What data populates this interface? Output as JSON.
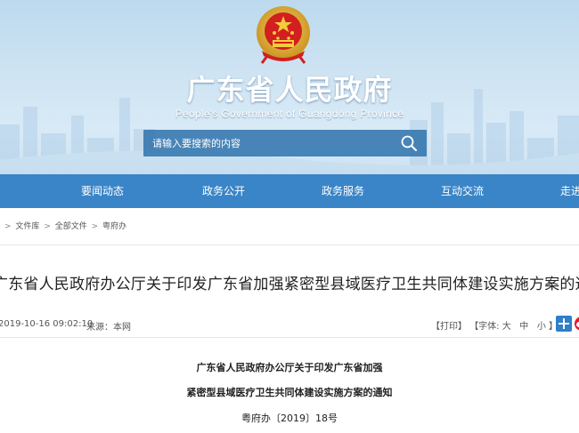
{
  "header": {
    "title": "广东省人民政府",
    "subtitle": "People's Government of Guangdong Province",
    "search_placeholder": "请输入要搜索的内容"
  },
  "nav": {
    "items": [
      {
        "label": "要闻动态"
      },
      {
        "label": "政务公开"
      },
      {
        "label": "政务服务"
      },
      {
        "label": "互动交流"
      },
      {
        "label": "走进"
      }
    ]
  },
  "breadcrumb": {
    "items": [
      "文件库",
      "全部文件",
      "粤府办"
    ]
  },
  "article": {
    "title": "广东省人民政府办公厅关于印发广东省加强紧密型县域医疗卫生共同体建设实施方案的通知",
    "publish_time": "2019-10-16 09:02:10",
    "source": "来源：本网",
    "print_label": "【打印】",
    "font_size_label": "【字体:",
    "font_large": "大",
    "font_medium": "中",
    "font_small": "小",
    "font_close": "】",
    "doc_title_line1": "广东省人民政府办公厅关于印发广东省加强",
    "doc_title_line2": "紧密型县域医疗卫生共同体建设实施方案的通知",
    "doc_number": "粤府办〔2019〕18号"
  },
  "colors": {
    "nav_bg": "#3a85c7",
    "search_bg": "#286eaa",
    "share_blue": "#2f7fc9"
  }
}
